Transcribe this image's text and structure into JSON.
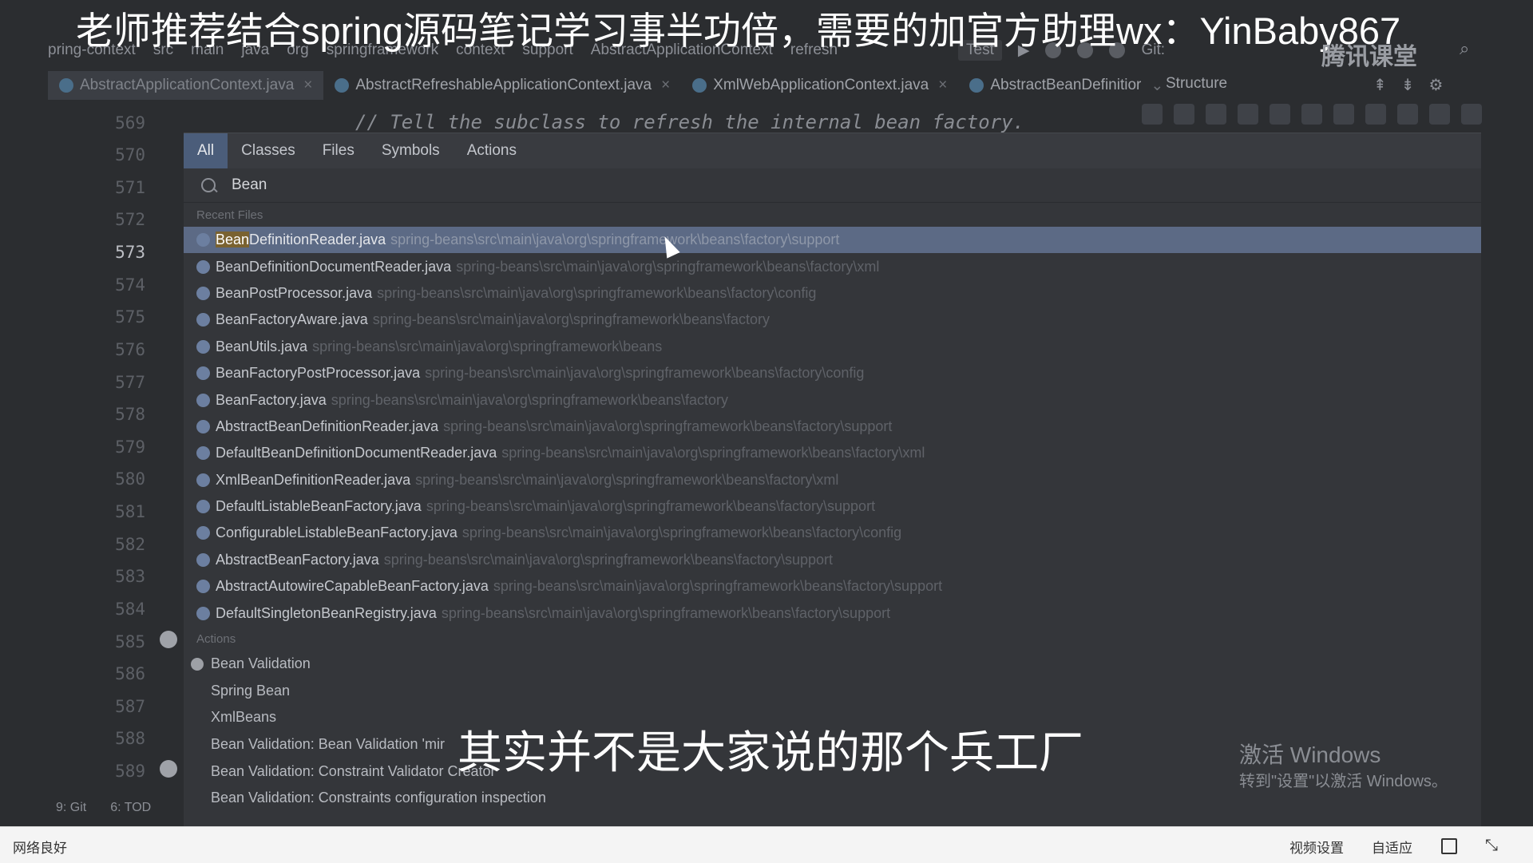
{
  "banner": {
    "title": "老师推荐结合spring源码笔记学习事半功倍，需要的加官方助理wx：YinBaby867",
    "logo": "腾讯课堂"
  },
  "breadcrumbs": [
    "pring-context",
    "src",
    "main",
    "java",
    "org",
    "springframework",
    "context",
    "support",
    "AbstractApplicationContext",
    "refresh"
  ],
  "toolbar": {
    "run_config": "Test",
    "vcs_label": "Git:"
  },
  "tabs": [
    {
      "label": "AbstractApplicationContext.java",
      "active": true
    },
    {
      "label": "AbstractRefreshableApplicationContext.java",
      "active": false
    },
    {
      "label": "XmlWebApplicationContext.java",
      "active": false
    },
    {
      "label": "AbstractBeanDefinitior",
      "active": false
    }
  ],
  "structure_label": "Structure",
  "editor": {
    "line_numbers": [
      "569",
      "570",
      "571",
      "572",
      "573",
      "574",
      "575",
      "576",
      "577",
      "578",
      "579",
      "580",
      "581",
      "582",
      "583",
      "584",
      "585",
      "586",
      "587",
      "588",
      "589"
    ],
    "current_line": "573",
    "code_comment": "// Tell the subclass to refresh the internal bean factory."
  },
  "search_popup": {
    "tabs": [
      "All",
      "Classes",
      "Files",
      "Symbols",
      "Actions"
    ],
    "active_tab": "All",
    "query": "Bean",
    "recent_files_label": "Recent Files",
    "recent_files": [
      {
        "name": "BeanDefinitionReader.java",
        "path": "spring-beans\\src\\main\\java\\org\\springframework\\beans\\factory\\support"
      },
      {
        "name": "BeanDefinitionDocumentReader.java",
        "path": "spring-beans\\src\\main\\java\\org\\springframework\\beans\\factory\\xml"
      },
      {
        "name": "BeanPostProcessor.java",
        "path": "spring-beans\\src\\main\\java\\org\\springframework\\beans\\factory\\config"
      },
      {
        "name": "BeanFactoryAware.java",
        "path": "spring-beans\\src\\main\\java\\org\\springframework\\beans\\factory"
      },
      {
        "name": "BeanUtils.java",
        "path": "spring-beans\\src\\main\\java\\org\\springframework\\beans"
      },
      {
        "name": "BeanFactoryPostProcessor.java",
        "path": "spring-beans\\src\\main\\java\\org\\springframework\\beans\\factory\\config"
      },
      {
        "name": "BeanFactory.java",
        "path": "spring-beans\\src\\main\\java\\org\\springframework\\beans\\factory"
      },
      {
        "name": "AbstractBeanDefinitionReader.java",
        "path": "spring-beans\\src\\main\\java\\org\\springframework\\beans\\factory\\support"
      },
      {
        "name": "DefaultBeanDefinitionDocumentReader.java",
        "path": "spring-beans\\src\\main\\java\\org\\springframework\\beans\\factory\\xml"
      },
      {
        "name": "XmlBeanDefinitionReader.java",
        "path": "spring-beans\\src\\main\\java\\org\\springframework\\beans\\factory\\xml"
      },
      {
        "name": "DefaultListableBeanFactory.java",
        "path": "spring-beans\\src\\main\\java\\org\\springframework\\beans\\factory\\support"
      },
      {
        "name": "ConfigurableListableBeanFactory.java",
        "path": "spring-beans\\src\\main\\java\\org\\springframework\\beans\\factory\\config"
      },
      {
        "name": "AbstractBeanFactory.java",
        "path": "spring-beans\\src\\main\\java\\org\\springframework\\beans\\factory\\support"
      },
      {
        "name": "AbstractAutowireCapableBeanFactory.java",
        "path": "spring-beans\\src\\main\\java\\org\\springframework\\beans\\factory\\support"
      },
      {
        "name": "DefaultSingletonBeanRegistry.java",
        "path": "spring-beans\\src\\main\\java\\org\\springframework\\beans\\factory\\support"
      }
    ],
    "actions_label": "Actions",
    "actions": [
      "Bean Validation",
      "Spring Bean",
      "XmlBeans",
      "Bean Validation: Bean Validation 'mir",
      "Bean Validation: Constraint Validator Creator",
      "Bean Validation: Constraints configuration inspection"
    ]
  },
  "subtitle": "其实并不是大家说的那个兵工厂",
  "windows_watermark": {
    "line1": "激活 Windows",
    "line2": "转到\"设置\"以激活 Windows。"
  },
  "bottom_tools": [
    "9: Git",
    "6: TOD"
  ],
  "player": {
    "network": "网络良好",
    "video_settings": "视频设置",
    "fit": "自适应"
  }
}
